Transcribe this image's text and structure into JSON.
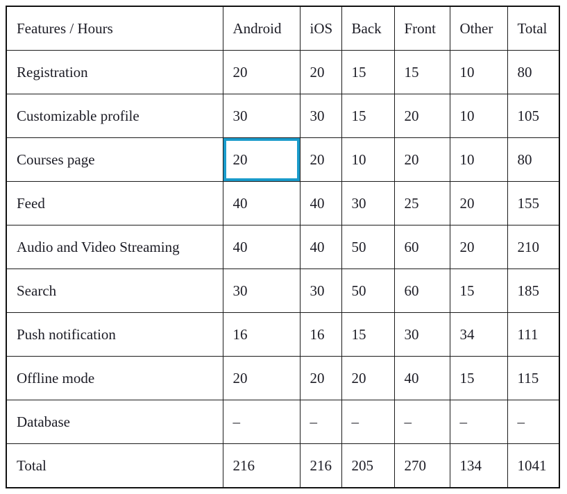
{
  "table": {
    "columns": [
      {
        "key": "feature",
        "label": "Features / Hours"
      },
      {
        "key": "android",
        "label": "Android"
      },
      {
        "key": "ios",
        "label": "iOS"
      },
      {
        "key": "back",
        "label": "Back"
      },
      {
        "key": "front",
        "label": "Front"
      },
      {
        "key": "other",
        "label": "Other"
      },
      {
        "key": "total",
        "label": "Total"
      }
    ],
    "rows": [
      {
        "feature": "Registration",
        "android": "20",
        "ios": "20",
        "back": "15",
        "front": "15",
        "other": "10",
        "total": "80"
      },
      {
        "feature": "Customizable profile",
        "android": "30",
        "ios": "30",
        "back": "15",
        "front": "20",
        "other": "10",
        "total": "105"
      },
      {
        "feature": "Courses page",
        "android": "20",
        "ios": "20",
        "back": "10",
        "front": "20",
        "other": "10",
        "total": "80"
      },
      {
        "feature": "Feed",
        "android": "40",
        "ios": "40",
        "back": "30",
        "front": "25",
        "other": "20",
        "total": "155"
      },
      {
        "feature": "Audio and Video Streaming",
        "android": "40",
        "ios": "40",
        "back": "50",
        "front": "60",
        "other": "20",
        "total": "210"
      },
      {
        "feature": "Search",
        "android": "30",
        "ios": "30",
        "back": "50",
        "front": "60",
        "other": "15",
        "total": "185"
      },
      {
        "feature": "Push notification",
        "android": "16",
        "ios": "16",
        "back": "15",
        "front": "30",
        "other": "34",
        "total": "111"
      },
      {
        "feature": "Offline mode",
        "android": "20",
        "ios": "20",
        "back": "20",
        "front": "40",
        "other": "15",
        "total": "115"
      },
      {
        "feature": "Database",
        "android": "–",
        "ios": "–",
        "back": "–",
        "front": "–",
        "other": "–",
        "total": "–"
      },
      {
        "feature": "Total",
        "android": "216",
        "ios": "216",
        "back": "205",
        "front": "270",
        "other": "134",
        "total": "1041"
      }
    ],
    "selection": {
      "row_index": 2,
      "column_key": "android",
      "value": "20",
      "color": "#1a9bcb"
    }
  },
  "chart_data": {
    "type": "table",
    "title": "Features / Hours",
    "categories": [
      "Registration",
      "Customizable profile",
      "Courses page",
      "Feed",
      "Audio and Video Streaming",
      "Search",
      "Push notification",
      "Offline mode",
      "Database",
      "Total"
    ],
    "series": [
      {
        "name": "Android",
        "values": [
          20,
          30,
          20,
          40,
          40,
          30,
          16,
          20,
          null,
          216
        ]
      },
      {
        "name": "iOS",
        "values": [
          20,
          30,
          20,
          40,
          40,
          30,
          16,
          20,
          null,
          216
        ]
      },
      {
        "name": "Back",
        "values": [
          15,
          15,
          10,
          30,
          50,
          50,
          15,
          20,
          null,
          205
        ]
      },
      {
        "name": "Front",
        "values": [
          15,
          20,
          20,
          25,
          60,
          60,
          30,
          40,
          null,
          270
        ]
      },
      {
        "name": "Other",
        "values": [
          10,
          10,
          10,
          20,
          20,
          15,
          34,
          15,
          null,
          134
        ]
      },
      {
        "name": "Total",
        "values": [
          80,
          105,
          80,
          155,
          210,
          185,
          111,
          115,
          null,
          1041
        ]
      }
    ],
    "xlabel": "Features",
    "ylabel": "Hours",
    "grid": true,
    "legend": "none"
  }
}
